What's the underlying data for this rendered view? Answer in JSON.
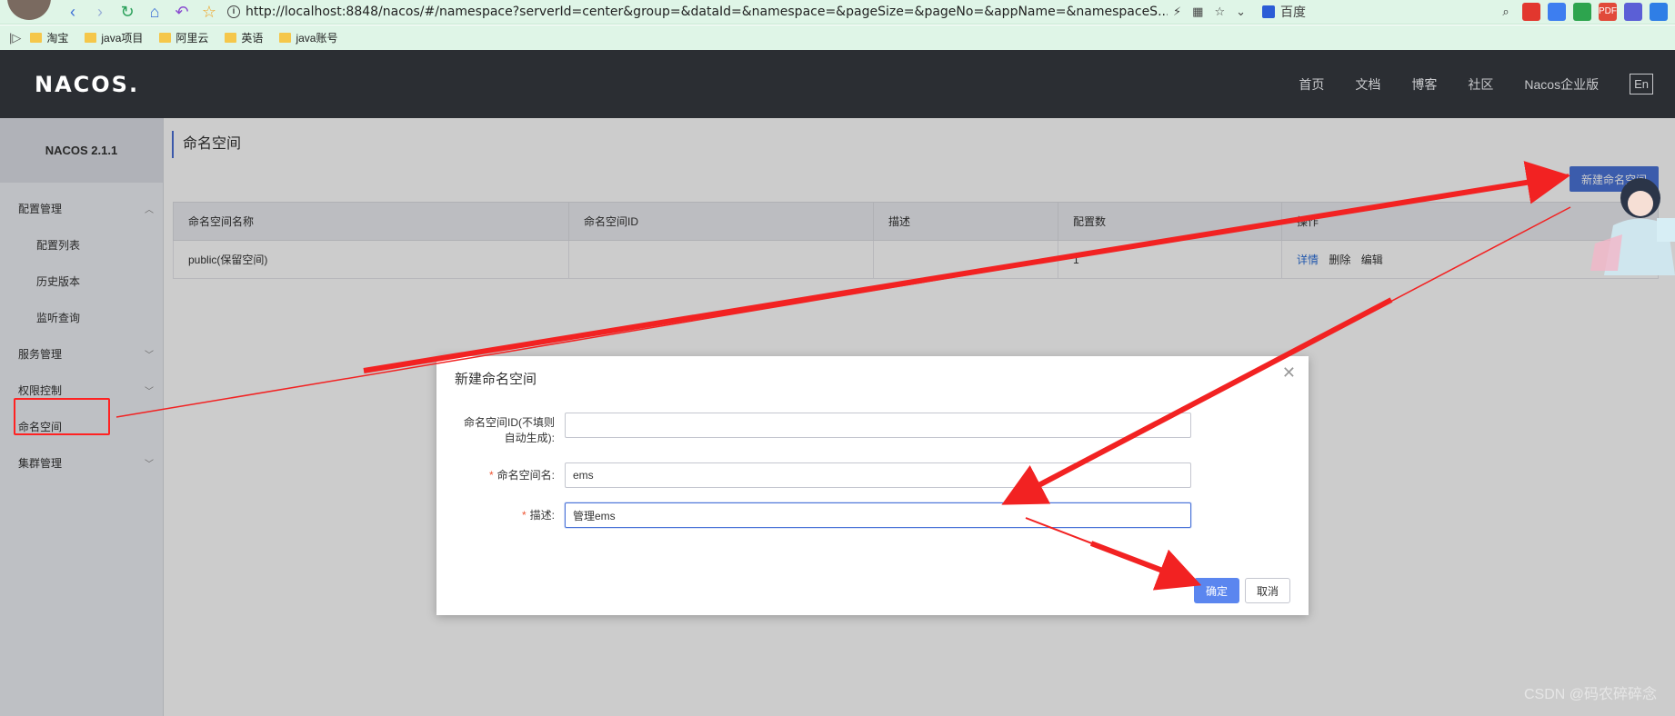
{
  "browser": {
    "url": "http://localhost:8848/nacos/#/namespace?serverId=center&group=&dataId=&namespace=&pageSize=&pageNo=&appName=&namespaceS...",
    "search_engine": "百度",
    "bookmarks": [
      "淘宝",
      "java项目",
      "阿里云",
      "英语",
      "java账号"
    ]
  },
  "header": {
    "logo": "NACOS.",
    "nav": [
      "首页",
      "文档",
      "博客",
      "社区",
      "Nacos企业版"
    ],
    "lang": "En"
  },
  "sidebar": {
    "version": "NACOS 2.1.1",
    "items": [
      {
        "label": "配置管理"
      },
      {
        "label": "配置列表"
      },
      {
        "label": "历史版本"
      },
      {
        "label": "监听查询"
      },
      {
        "label": "服务管理"
      },
      {
        "label": "权限控制"
      },
      {
        "label": "命名空间"
      },
      {
        "label": "集群管理"
      }
    ]
  },
  "main": {
    "title": "命名空间",
    "new_button": "新建命名空间",
    "table": {
      "columns": [
        "命名空间名称",
        "命名空间ID",
        "描述",
        "配置数",
        "操作"
      ],
      "rows": [
        {
          "name": "public(保留空间)",
          "id": "",
          "desc": "",
          "count": "1",
          "ops": [
            "详情",
            "删除",
            "编辑"
          ]
        }
      ]
    }
  },
  "dialog": {
    "title": "新建命名空间",
    "fields": [
      {
        "label_line1": "命名空间ID(不填则",
        "label_line2": "自动生成):",
        "value": ""
      },
      {
        "label": "命名空间名:",
        "value": "ems"
      },
      {
        "label": "描述:",
        "value": "管理ems"
      }
    ],
    "ok": "确定",
    "cancel": "取消"
  },
  "watermark": "CSDN @码农碎碎念",
  "colors": {
    "annotation": "#f22222",
    "primary": "#4a73d8",
    "header": "#2b2e33"
  }
}
